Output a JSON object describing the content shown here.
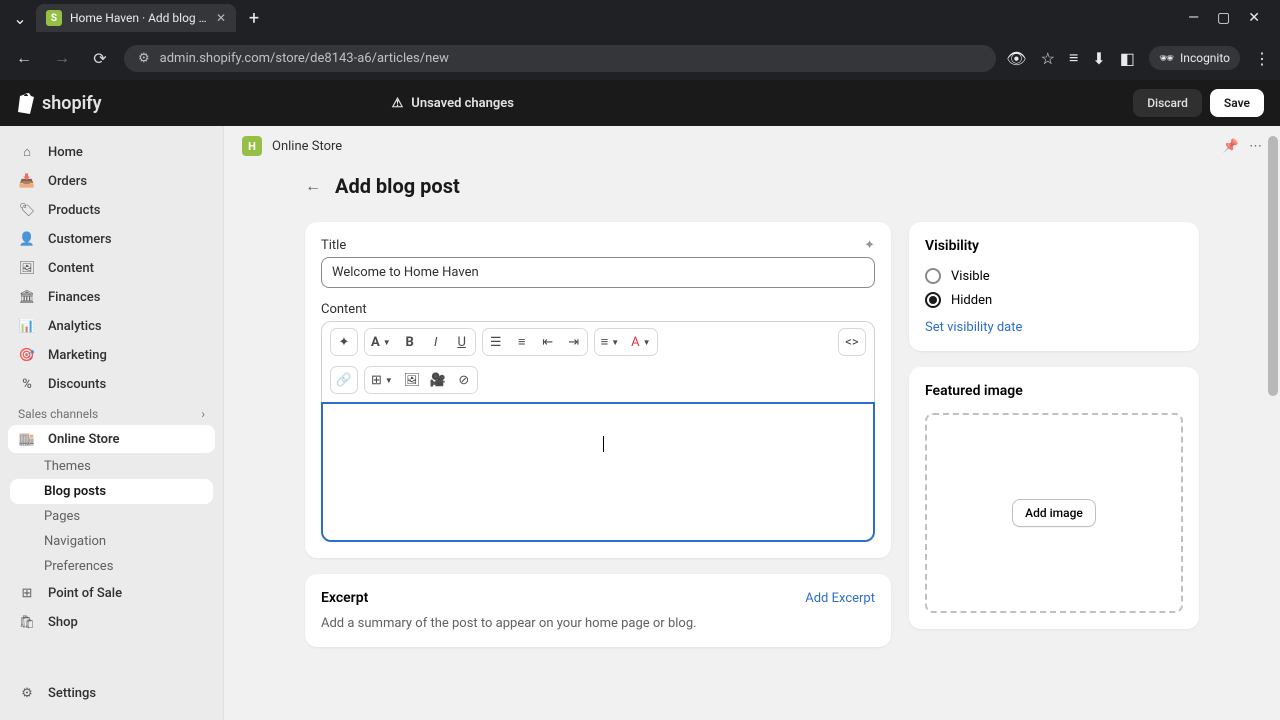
{
  "browser": {
    "tab_title": "Home Haven · Add blog post ·",
    "url": "admin.shopify.com/store/de8143-a6/articles/new",
    "incognito_label": "Incognito"
  },
  "topbar": {
    "brand": "shopify",
    "unsaved_label": "Unsaved changes",
    "discard_label": "Discard",
    "save_label": "Save"
  },
  "sidebar": {
    "items": [
      {
        "label": "Home"
      },
      {
        "label": "Orders"
      },
      {
        "label": "Products"
      },
      {
        "label": "Customers"
      },
      {
        "label": "Content"
      },
      {
        "label": "Finances"
      },
      {
        "label": "Analytics"
      },
      {
        "label": "Marketing"
      },
      {
        "label": "Discounts"
      }
    ],
    "section_label": "Sales channels",
    "online_store": {
      "label": "Online Store",
      "sub": [
        {
          "label": "Themes"
        },
        {
          "label": "Blog posts"
        },
        {
          "label": "Pages"
        },
        {
          "label": "Navigation"
        },
        {
          "label": "Preferences"
        }
      ]
    },
    "point_of_sale": "Point of Sale",
    "shop": "Shop",
    "settings": "Settings"
  },
  "channel_bar": {
    "name": "Online Store"
  },
  "page": {
    "title": "Add blog post",
    "title_label": "Title",
    "title_value": "Welcome to Home Haven",
    "content_label": "Content",
    "excerpt_heading": "Excerpt",
    "add_excerpt": "Add Excerpt",
    "excerpt_desc": "Add a summary of the post to appear on your home page or blog."
  },
  "visibility": {
    "heading": "Visibility",
    "visible_label": "Visible",
    "hidden_label": "Hidden",
    "set_date": "Set visibility date"
  },
  "featured": {
    "heading": "Featured image",
    "add_image": "Add image"
  }
}
